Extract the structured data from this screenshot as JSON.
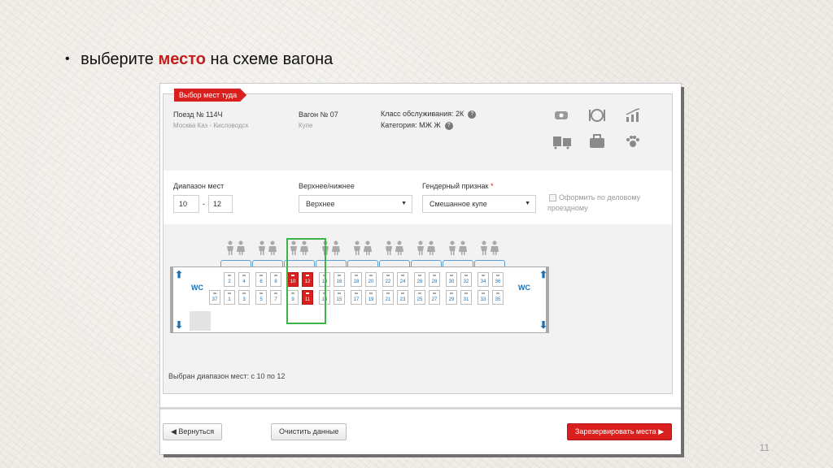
{
  "slide": {
    "title_pre": "выберите",
    "title_accent": "место",
    "title_post": "на схеме вагона",
    "number": "11"
  },
  "panel": {
    "tag": "Выбор мест туда",
    "train_label": "Поезд № 114Ч",
    "route": "Москва Каз - Кисловодск",
    "wagon_label": "Вагон № 07",
    "wagon_type": "Купе",
    "class_label": "Класс обслуживания: 2К",
    "category_label": "Категория: МЖ Ж",
    "service_icons": [
      "tv-icon",
      "meal-icon",
      "chart-icon",
      "transfer-icon",
      "bag-icon",
      "pet-paw-icon"
    ]
  },
  "filters": {
    "range_label": "Диапазон мест",
    "range_from": "10",
    "range_dash": "-",
    "range_to": "12",
    "berth_label": "Верхнее/нижнее",
    "berth_value": "Верхнее",
    "gender_label": "Гендерный признак",
    "gender_required": "*",
    "gender_value": "Смешанное купе",
    "business_line1": "Оформить по деловому",
    "business_line2": "проездному"
  },
  "scheme": {
    "wc_left": "WC",
    "wc_right": "WC",
    "upper_seats": [
      "2",
      "4",
      "6",
      "8",
      "10",
      "12",
      "14",
      "16",
      "18",
      "20",
      "22",
      "24",
      "26",
      "28",
      "30",
      "32",
      "34",
      "36"
    ],
    "lower_seats": [
      "37",
      "1",
      "3",
      "5",
      "7",
      "9",
      "11",
      "13",
      "15",
      "17",
      "19",
      "21",
      "23",
      "25",
      "27",
      "29",
      "31",
      "33",
      "35"
    ],
    "selected_seats": [
      "10",
      "12",
      "11"
    ],
    "selected_text": "Выбран диапазон мест: с 10 по 12"
  },
  "actions": {
    "back": "◀  Вернуться",
    "clear": "Очистить данные",
    "reserve": "Зарезервировать места  ▶"
  },
  "colors": {
    "accent": "#d9201f",
    "highlight": "#3db34a",
    "seat_text": "#1f6fb0"
  }
}
